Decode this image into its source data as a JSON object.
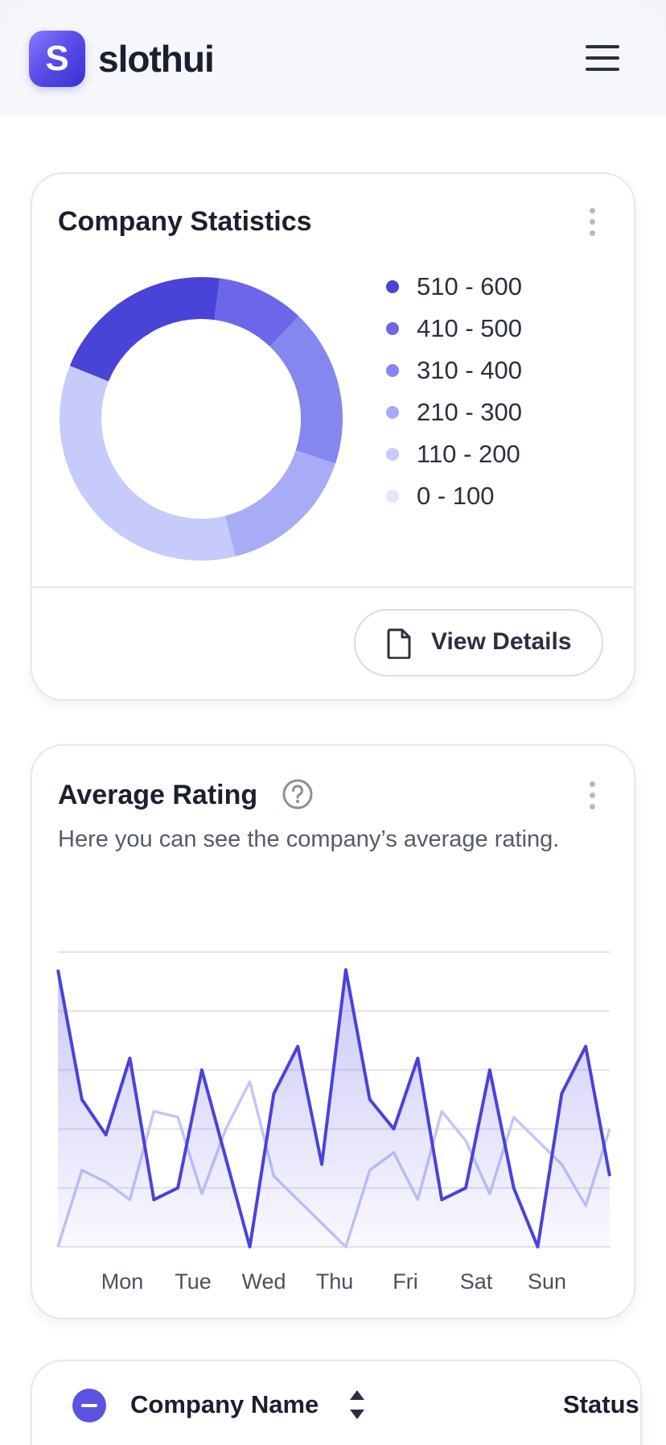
{
  "app": {
    "logo_letter": "S",
    "brand": "slothui",
    "menu_icon": "hamburger-menu-icon"
  },
  "company_statistics": {
    "title": "Company Statistics",
    "more_icon": "vertical-dots-icon",
    "view_details_label": "View Details",
    "view_details_icon": "document-icon",
    "chart_data": {
      "type": "pie",
      "variant": "donut",
      "legend_position": "right",
      "categories": [
        "510 - 600",
        "410 - 500",
        "310 - 400",
        "210 - 300",
        "110 - 200",
        "0 - 100"
      ],
      "colors": [
        "#4a43d8",
        "#6b67e8",
        "#8587ee",
        "#a8acf6",
        "#c6cbfb",
        "#e2e5fd"
      ],
      "values": [
        21,
        10,
        18,
        16,
        35,
        0
      ]
    }
  },
  "average_rating": {
    "title": "Average Rating",
    "help_icon": "question-circle-icon",
    "more_icon": "vertical-dots-icon",
    "subtitle": "Here you can see the company’s average rating.",
    "chart_data": {
      "type": "area",
      "grid": true,
      "xlabel": "",
      "ylabel": "",
      "ylim": [
        0,
        5
      ],
      "x_tick_labels": [
        "Mon",
        "Tue",
        "Wed",
        "Thu",
        "Fri",
        "Sat",
        "Sun"
      ],
      "series": [
        {
          "color": "#4a43d8",
          "fill": true,
          "values": [
            4.7,
            2.5,
            1.9,
            3.2,
            0.8,
            1.0,
            3.0,
            1.5,
            0.0,
            2.6,
            3.4,
            1.4,
            4.7,
            2.5,
            2.0,
            3.2,
            0.8,
            1.0,
            3.0,
            1.0,
            0.0,
            2.6,
            3.4,
            1.2
          ]
        },
        {
          "color": "#c3c6f7",
          "fill": false,
          "values": [
            0.0,
            1.3,
            1.1,
            0.8,
            2.3,
            2.2,
            0.9,
            2.0,
            2.8,
            1.2,
            0.8,
            0.4,
            0.0,
            1.3,
            1.6,
            0.8,
            2.3,
            1.8,
            0.9,
            2.2,
            1.8,
            1.4,
            0.7,
            2.0
          ]
        }
      ]
    }
  },
  "table": {
    "select_all_icon": "minus-checkbox-icon",
    "col_company_name": "Company Name",
    "sort_icon": "sort-updown-icon",
    "col_status": "Status"
  }
}
